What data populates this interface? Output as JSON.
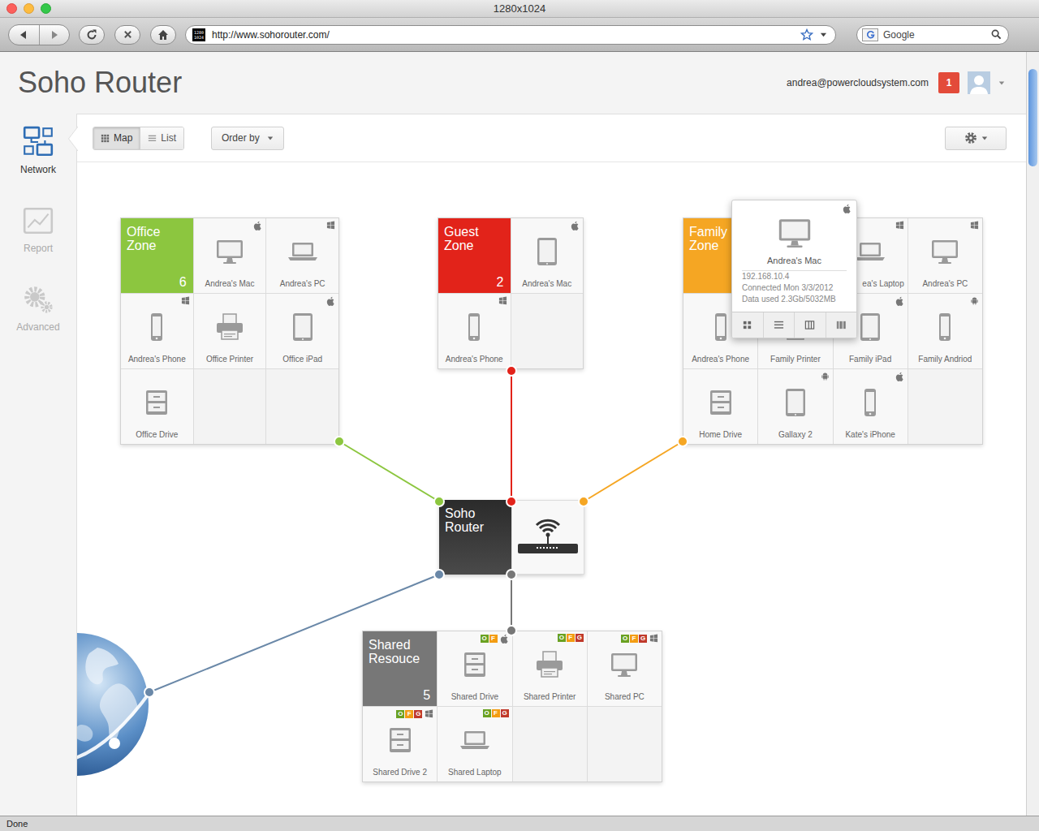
{
  "window": {
    "title": "1280x1024"
  },
  "browser": {
    "favicon": [
      "1280",
      "1024"
    ],
    "url": "http://www.sohorouter.com/",
    "search_placeholder": "Google",
    "status": "Done"
  },
  "app": {
    "title": "Soho Router",
    "user": "andrea@powercloudsystem.com",
    "notifications": "1"
  },
  "sidebar": {
    "items": [
      {
        "label": "Network",
        "selected": true
      },
      {
        "label": "Report",
        "selected": false
      },
      {
        "label": "Advanced",
        "selected": false
      }
    ]
  },
  "view_toggle": [
    {
      "label": "Map",
      "selected": true
    },
    {
      "label": "List",
      "selected": false
    }
  ],
  "order_by": {
    "label": "Order by"
  },
  "zones": [
    {
      "title": "Office Zone",
      "count": "6",
      "color": "#8cc63f",
      "devices": [
        {
          "label": "Andrea's Mac",
          "kind": "desktop",
          "os": "apple"
        },
        {
          "label": "Andrea's PC",
          "kind": "laptop",
          "os": "windows"
        },
        {
          "label": "Andrea's Phone",
          "kind": "phone",
          "os": "windows"
        },
        {
          "label": "Office Printer",
          "kind": "printer",
          "os": "none"
        },
        {
          "label": "Office iPad",
          "kind": "tablet",
          "os": "apple"
        },
        {
          "label": "Office Drive",
          "kind": "drive",
          "os": "none"
        }
      ]
    },
    {
      "title": "Guest Zone",
      "count": "2",
      "color": "#e2231a",
      "devices": [
        {
          "label": "Andrea's Mac",
          "kind": "tablet",
          "os": "apple"
        },
        {
          "label": "Andrea's Phone",
          "kind": "phone",
          "os": "windows"
        }
      ]
    },
    {
      "title": "Family Zone",
      "color": "#f5a623",
      "devices": [
        {
          "kind": "covered"
        },
        {
          "label": "ea's Laptop",
          "kind": "laptop",
          "os": "windows"
        },
        {
          "label": "Andrea's PC",
          "kind": "desktop",
          "os": "windows"
        },
        {
          "label": "Andrea's Phone",
          "kind": "phone",
          "os": "none"
        },
        {
          "label": "Family Printer",
          "kind": "printer",
          "os": "none"
        },
        {
          "label": "Family iPad",
          "kind": "tablet",
          "os": "apple"
        },
        {
          "label": "Family Andriod",
          "kind": "phone",
          "os": "android"
        },
        {
          "label": "Home Drive",
          "kind": "drive",
          "os": "none"
        },
        {
          "label": "Gallaxy 2",
          "kind": "tablet",
          "os": "android"
        },
        {
          "label": "Kate's iPhone",
          "kind": "phone",
          "os": "apple"
        }
      ]
    },
    {
      "title": "Shared Resouce",
      "count": "5",
      "color": "#777777",
      "devices": [
        {
          "label": "Shared Drive",
          "kind": "drive",
          "os": "apple",
          "tags": [
            {
              "label": "O",
              "color": "#6aa121"
            },
            {
              "label": "F",
              "color": "#f39c12"
            }
          ]
        },
        {
          "label": "Shared Printer",
          "kind": "printer",
          "os": "none",
          "tags": [
            {
              "label": "O",
              "color": "#6aa121"
            },
            {
              "label": "F",
              "color": "#f39c12"
            },
            {
              "label": "G",
              "color": "#c0392b"
            }
          ]
        },
        {
          "label": "Shared PC",
          "kind": "desktop",
          "os": "windows",
          "tags": [
            {
              "label": "O",
              "color": "#6aa121"
            },
            {
              "label": "F",
              "color": "#f39c12"
            },
            {
              "label": "G",
              "color": "#c0392b"
            }
          ]
        },
        {
          "label": "Shared Drive 2",
          "kind": "drive",
          "os": "windows",
          "tags": [
            {
              "label": "O",
              "color": "#6aa121"
            },
            {
              "label": "F",
              "color": "#f39c12"
            },
            {
              "label": "G",
              "color": "#c0392b"
            }
          ]
        },
        {
          "label": "Shared Laptop",
          "kind": "laptop",
          "os": "none",
          "tags": [
            {
              "label": "O",
              "color": "#6aa121"
            },
            {
              "label": "F",
              "color": "#f39c12"
            },
            {
              "label": "G",
              "color": "#c0392b"
            }
          ]
        }
      ]
    }
  ],
  "router": {
    "title": "Soho Router"
  },
  "tooltip": {
    "name": "Andrea's Mac",
    "kind": "desktop",
    "os": "apple",
    "ip": "192.168.10.4",
    "connected": "Connected Mon 3/3/2012",
    "data_used": "Data used 2.3Gb/5032MB"
  }
}
